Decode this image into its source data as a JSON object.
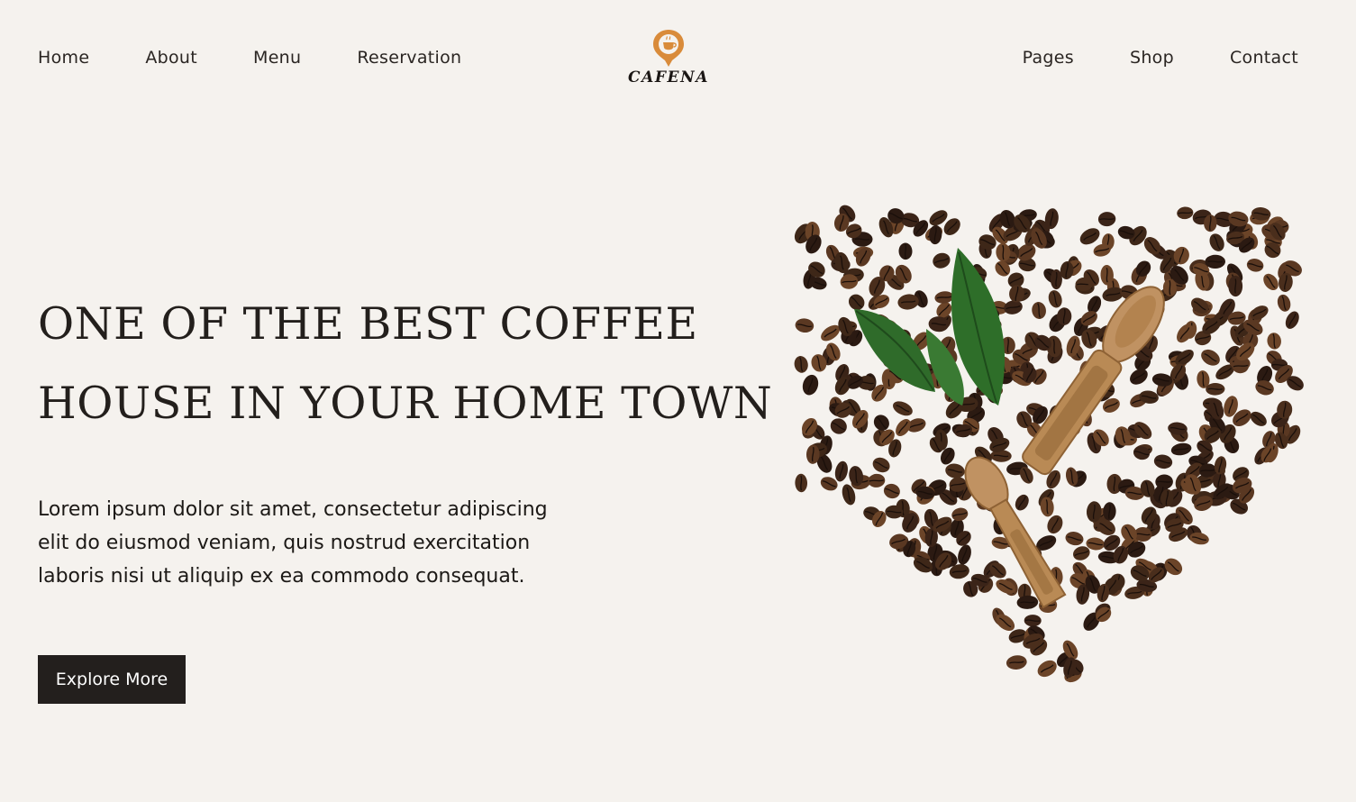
{
  "nav": {
    "left": [
      "Home",
      "About",
      "Menu",
      "Reservation"
    ],
    "right": [
      "Pages",
      "Shop",
      "Contact"
    ]
  },
  "logo": {
    "text": "CAFENA",
    "icon": "coffee-cup-location-pin-icon",
    "accent_color": "#d98b3a"
  },
  "hero": {
    "title_line1": "ONE OF THE BEST COFFEE",
    "title_line2": "HOUSE IN YOUR HOME TOWN",
    "description": "Lorem ipsum dolor sit amet, consectetur adipiscing elit do eiusmod veniam, quis nostrud exercitation laboris nisi ut aliquip ex ea commodo consequat.",
    "button_label": "Explore More",
    "image": "coffee-beans-heart-with-wooden-scoops-and-leaves"
  },
  "colors": {
    "background": "#f5f2ee",
    "text": "#231f1c",
    "button_bg": "#231f1d",
    "button_text": "#ffffff",
    "bean": "#3b2418",
    "leaf": "#2f6b2a",
    "scoop": "#b98a55"
  }
}
